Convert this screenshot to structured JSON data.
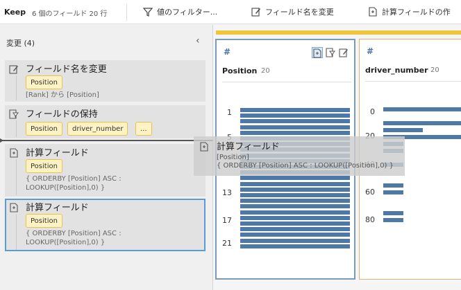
{
  "toolbar": {
    "keep_label": "Keep",
    "field_count": "6 個のフィールド 20 行",
    "filter_label": "値のフィルター...",
    "rename_label": "フィールド名を変更",
    "calc_label": "計算フィールドの作"
  },
  "changes_panel": {
    "title": "変更 (4)",
    "collapse_icon": "chevron-left-icon",
    "changes": [
      {
        "icon": "rename-icon",
        "title": "フィールド名を変更",
        "chips": [
          "Position"
        ],
        "desc": "[Rank] から [Position]"
      },
      {
        "icon": "keep-icon",
        "title": "フィールドの保持",
        "chips": [
          "Position",
          "driver_number",
          "..."
        ],
        "desc": ""
      },
      {
        "icon": "calc-icon",
        "title": "計算フィールド",
        "chips": [
          "Position"
        ],
        "desc_lines": [
          "{ ORDERBY [Position] ASC :",
          "LOOKUP([Position],0) }"
        ]
      },
      {
        "icon": "calc-icon",
        "title": "計算フィールド",
        "chips": [
          "Position"
        ],
        "desc_lines": [
          "{ ORDERBY [Position] ASC :",
          "LOOKUP([Position],0) }"
        ]
      }
    ]
  },
  "drag_preview": {
    "title": "計算フィールド",
    "desc_line1": "[Position]",
    "desc_line2": "{ ORDERBY [Position] ASC : LOOKUP([Position],0) }"
  },
  "profiles": [
    {
      "type_icon": "#",
      "name": "Position",
      "count": "20",
      "ticks": [
        "1",
        "5",
        "13",
        "17",
        "21"
      ],
      "bars": [
        1,
        1,
        1,
        1,
        1,
        1,
        1,
        1,
        1,
        1,
        1,
        1,
        1,
        1,
        1,
        1,
        1,
        1,
        1,
        1,
        1,
        1,
        1,
        1,
        1
      ]
    },
    {
      "type_icon": "#",
      "name": "driver_number",
      "count": "20",
      "ticks": [
        "0",
        "20",
        "40",
        "60",
        "80"
      ],
      "bars": [
        1,
        0,
        1,
        0.5,
        1,
        0.25,
        0.25,
        0,
        0.25,
        0,
        0,
        0.25,
        0.25,
        0,
        0,
        0.25,
        0.25
      ]
    }
  ],
  "colors": {
    "accent": "#4e79a7",
    "chip_bg": "#fff3c6",
    "chip_border": "#e8c24c",
    "progress": "#f0c53a"
  }
}
